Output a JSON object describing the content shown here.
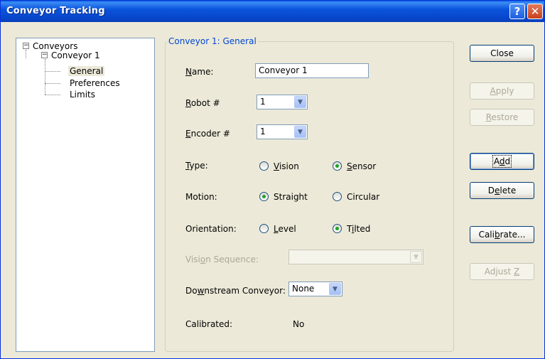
{
  "window": {
    "title": "Conveyor Tracking",
    "help_glyph": "?",
    "close_glyph": "✕"
  },
  "tree": {
    "root": "Conveyors",
    "child": "Conveyor 1",
    "leaves": [
      "General",
      "Preferences",
      "Limits"
    ],
    "expander_glyph": "−"
  },
  "group": {
    "title": "Conveyor 1: General"
  },
  "fields": {
    "name_label": "Name:",
    "name_value": "Conveyor 1",
    "robot_label": "Robot #",
    "robot_value": "1",
    "encoder_label": "Encoder #",
    "encoder_value": "1",
    "type_label": "Type:",
    "type_options": [
      "Vision",
      "Sensor"
    ],
    "type_selected": "Sensor",
    "motion_label": "Motion:",
    "motion_options": [
      "Straight",
      "Circular"
    ],
    "motion_selected": "Straight",
    "orientation_label": "Orientation:",
    "orientation_options": [
      "Level",
      "Tilted"
    ],
    "orientation_selected": "Tilted",
    "vision_sequence_label": "Vision Sequence:",
    "vision_sequence_value": "",
    "downstream_label": "Downstream Conveyor:",
    "downstream_value": "None",
    "calibrated_label": "Calibrated:",
    "calibrated_value": "No"
  },
  "buttons": {
    "close": "Close",
    "apply": "Apply",
    "restore": "Restore",
    "add": "Add",
    "delete": "Delete",
    "calibrate": "Calibrate...",
    "adjust_z": "Adjust Z"
  },
  "icons": {
    "dropdown_arrow": "chevron-down-icon",
    "expander": "minus-box-icon"
  },
  "colors": {
    "title_bar": "#0a54dc",
    "group_title": "#0046d5",
    "radio_dot": "#21a121",
    "disabled_text": "#aca899"
  }
}
